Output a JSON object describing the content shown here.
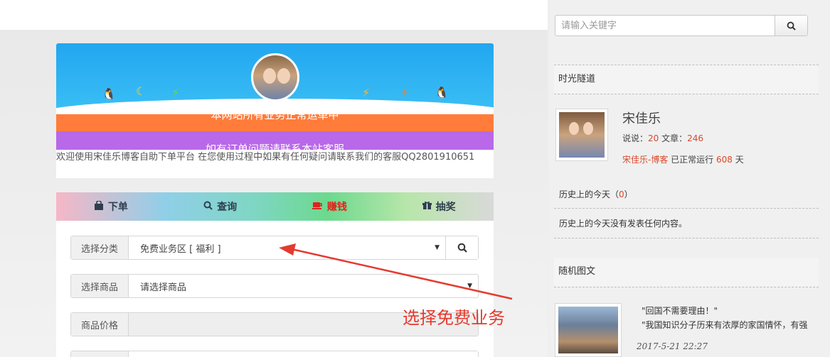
{
  "banner": {
    "notice_orange": "本网站所有业务正常运单中",
    "notice_purple": "如有订单问题请联系本站客服",
    "welcome": "欢迎使用宋佳乐博客自助下单平台 在您使用过程中如果有任何疑问请联系我们的客服QQ2801910651"
  },
  "tabs": [
    {
      "label": "下单",
      "icon": "shopping-bag-icon"
    },
    {
      "label": "查询",
      "icon": "search-icon"
    },
    {
      "label": "赚钱",
      "icon": "coffee-cup-icon",
      "active": true
    },
    {
      "label": "抽奖",
      "icon": "gift-icon"
    }
  ],
  "form": {
    "category_label": "选择分类",
    "category_value": "免费业务区 [ 福利 ]",
    "product_label": "选择商品",
    "product_value": "请选择商品",
    "price_label": "商品价格"
  },
  "annotation": "选择免费业务",
  "sidebar": {
    "search_placeholder": "请输入关键字",
    "tunnel_title": "时光隧道",
    "author_name": "宋佳乐",
    "talk_label": "说说：",
    "talk_count": "20",
    "article_label": " 文章：",
    "article_count": "246",
    "blog_link": "宋佳乐-博客",
    "running_prefix": " 已正常运行 ",
    "running_days": "608",
    "running_suffix": " 天",
    "history_title": "历史上的今天",
    "history_count_open": "（",
    "history_count": "0",
    "history_count_close": "）",
    "history_empty": "历史上的今天没有发表任何内容。",
    "random_title": "随机图文",
    "post_title": "\"回国不需要理由！\"",
    "post_excerpt": "\"我国知识分子历来有浓厚的家国情怀，有强",
    "post_date": "2017-5-21  22:27"
  },
  "colors": {
    "accent_red": "#e2211c",
    "number_orange": "#d9482b",
    "strip_orange": "#ff7c3a",
    "strip_purple": "#b868e8",
    "banner_blue": "#22a6f0"
  }
}
